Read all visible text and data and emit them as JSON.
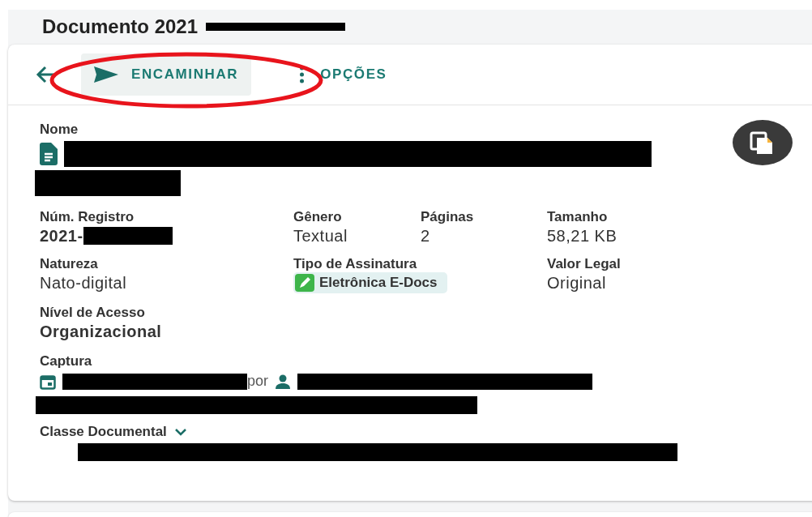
{
  "page": {
    "title": "Documento 2021"
  },
  "toolbar": {
    "forward": {
      "label": "ENCAMINHAR",
      "highlighted": true
    },
    "options": {
      "label": "OPÇÕES"
    }
  },
  "name_field": {
    "label": "Nome"
  },
  "rows": [
    [
      {
        "label": "Núm. Registro",
        "value": "2021-",
        "kind": "strong_redacted"
      },
      {
        "label": "Gênero",
        "value": "Textual",
        "kind": "plain"
      },
      {
        "label": "Páginas",
        "value": "2",
        "kind": "plain"
      },
      {
        "label": "Tamanho",
        "value": "58,21 KB",
        "kind": "plain"
      }
    ],
    [
      {
        "label": "Natureza",
        "value": "Nato-digital",
        "kind": "plain"
      },
      {
        "label": "Tipo de Assinatura",
        "value": "Eletrônica E-Docs",
        "kind": "badge"
      },
      {
        "label": "Valor Legal",
        "value": "Original",
        "kind": "plain"
      }
    ],
    [
      {
        "label": "Nível de Acesso",
        "value": "Organizacional",
        "kind": "strong"
      }
    ]
  ],
  "capture": {
    "label": "Captura",
    "by": "por"
  },
  "doc_class": {
    "label": "Classe Documental",
    "expanded": false
  }
}
